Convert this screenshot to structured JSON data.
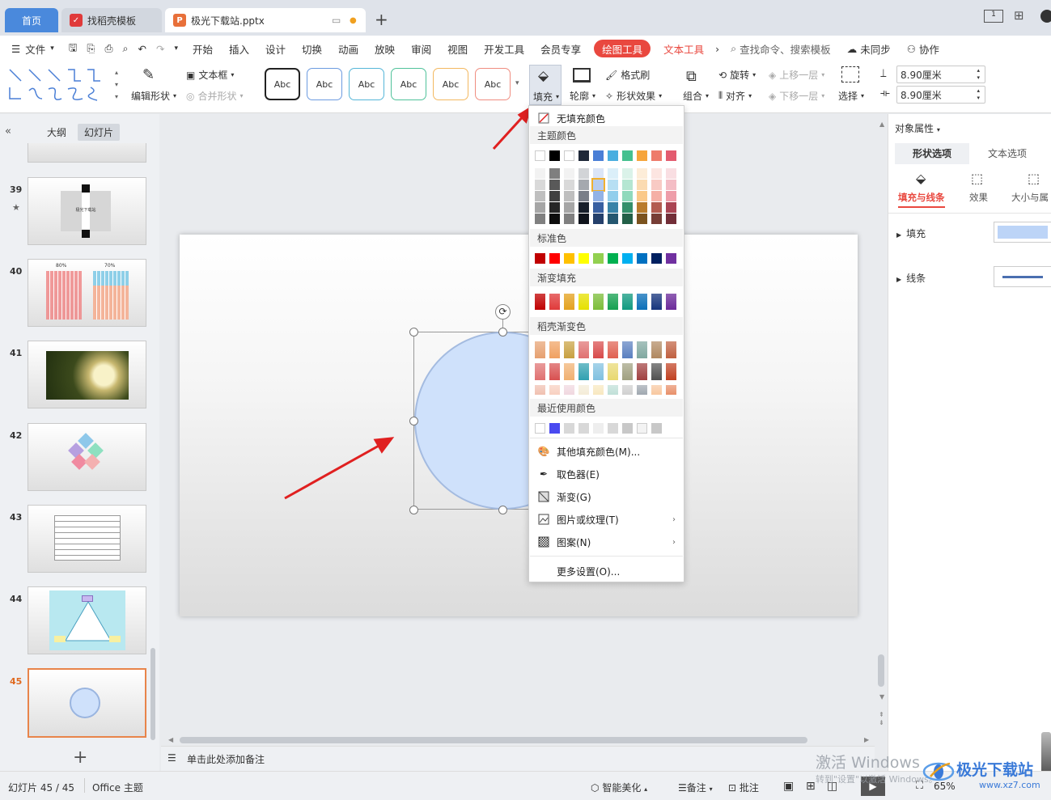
{
  "tabs": {
    "home": "首页",
    "daoke": "找稻壳模板",
    "file": "极光下载站.pptx"
  },
  "menu": {
    "file": "文件",
    "items": [
      "开始",
      "插入",
      "设计",
      "切换",
      "动画",
      "放映",
      "审阅",
      "视图",
      "开发工具",
      "会员专享"
    ],
    "drawing_tools": "绘图工具",
    "text_tools": "文本工具",
    "search": "查找命令、搜索模板",
    "unsynced": "未同步",
    "collab": "协作"
  },
  "ribbon": {
    "edit_shape": "编辑形状",
    "textbox": "文本框",
    "merge_shape": "合并形状",
    "style_label": "Abc",
    "fill": "填充",
    "outline": "轮廓",
    "format_painter": "格式刷",
    "shape_effect": "形状效果",
    "group": "组合",
    "rotate": "旋转",
    "align": "对齐",
    "bring_forward": "上移一层",
    "send_backward": "下移一层",
    "select": "选择",
    "height": "8.90厘米",
    "width": "8.90厘米"
  },
  "left_panel": {
    "outline_tab": "大纲",
    "slides_tab": "幻灯片",
    "slide_numbers": [
      "39",
      "40",
      "41",
      "42",
      "43",
      "44",
      "45"
    ],
    "thumb39_text": "极光下载站",
    "thumb40_labels": [
      "80%",
      "70%"
    ]
  },
  "fill_menu": {
    "no_fill": "无填充颜色",
    "theme_colors": "主题颜色",
    "standard_colors": "标准色",
    "gradient_fill": "渐变填充",
    "daoke_gradient": "稻壳渐变色",
    "recent": "最近使用颜色",
    "more_colors": "其他填充颜色(M)...",
    "eyedropper": "取色器(E)",
    "gradient": "渐变(G)",
    "picture_texture": "图片或纹理(T)",
    "pattern": "图案(N)",
    "more_settings": "更多设置(O)...",
    "theme_top": [
      "#ffffff",
      "#000000",
      "#ffffff",
      "#1f2838",
      "#4a7fd6",
      "#4aaee0",
      "#45c08f",
      "#f6a53b",
      "#ee7b6b",
      "#e35b6f"
    ],
    "standard": [
      "#c00000",
      "#ff0000",
      "#ffc000",
      "#ffff00",
      "#92d050",
      "#00b050",
      "#00b0f0",
      "#0070c0",
      "#002060",
      "#7030a0"
    ],
    "gradient_colors": [
      "#c00000",
      "#e03a3a",
      "#e4a21e",
      "#e6e000",
      "#7cbd3a",
      "#15a050",
      "#119a80",
      "#0b6fb8",
      "#16347c",
      "#6b2a9a"
    ],
    "recent_colors": [
      "#ffffff",
      "#4a4af0",
      "#d8d8d8",
      "#d8d8d8",
      "#eeeeee",
      "#d8d8d8",
      "#c8c8c8",
      "#f3f3f3",
      "#c8c8c8"
    ]
  },
  "right_panel": {
    "title": "对象属性",
    "tab_shape": "形状选项",
    "tab_text": "文本选项",
    "fill_line": "填充与线条",
    "effect": "效果",
    "size": "大小与属",
    "fill": "填充",
    "line": "线条"
  },
  "notes_placeholder": "单击此处添加备注",
  "status": {
    "slide_count": "幻灯片 45 / 45",
    "theme": "Office 主题",
    "beautify": "智能美化",
    "notes": "备注",
    "comments": "批注",
    "zoom": "65%"
  },
  "watermark": {
    "windows": "激活 Windows",
    "windows_sub": "转到\"设置\"以激活 Windows。",
    "site": "极光下载站",
    "url": "www.xz7.com"
  }
}
